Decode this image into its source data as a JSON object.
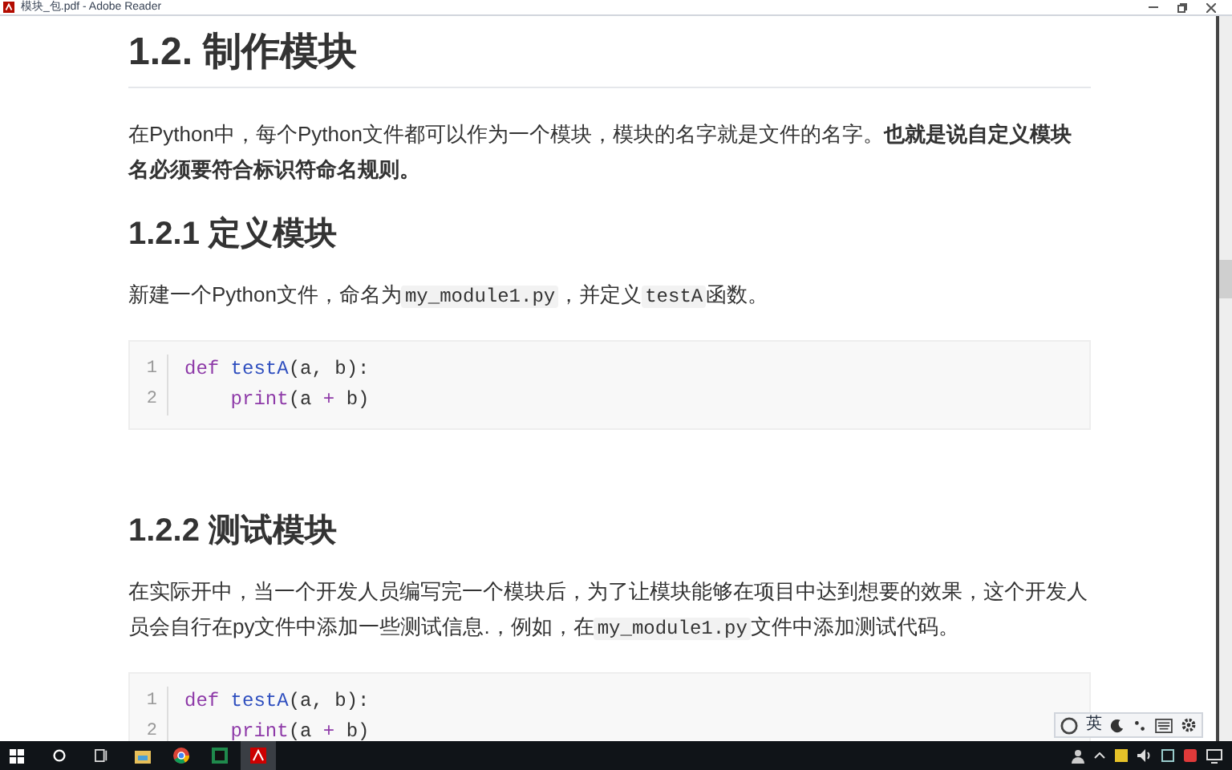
{
  "window": {
    "title": "模块_包.pdf - Adobe Reader"
  },
  "document": [
    {
      "kind": "h1",
      "text": "1.2. 制作模块"
    },
    {
      "kind": "para",
      "segments": [
        {
          "kind": "text",
          "text": "在Python中，每个Python文件都可以作为一个模块，模块的名字就是文件的名字。**也就是说自定义模块名必须要符合标识符命名规则。**"
        }
      ]
    },
    {
      "kind": "h2",
      "text": "1.2.1 定义模块"
    },
    {
      "kind": "para",
      "segments": [
        {
          "kind": "text",
          "text": "新建一个Python文件，命名为"
        },
        {
          "kind": "code",
          "text": "my_module1.py"
        },
        {
          "kind": "text",
          "text": "，并定义"
        },
        {
          "kind": "code",
          "text": "testA"
        },
        {
          "kind": "text",
          "text": "函数。"
        }
      ]
    },
    {
      "kind": "code",
      "lines": [
        {
          "number": "1",
          "tokens": [
            {
              "kind": "keyword",
              "text": "def"
            },
            {
              "kind": "function",
              "text": " testA"
            },
            {
              "kind": "plain",
              "text": "(a, b):"
            }
          ]
        },
        {
          "number": "2",
          "tokens": [
            {
              "kind": "keyword",
              "text": "    print"
            },
            {
              "kind": "plain",
              "text": "(a "
            },
            {
              "kind": "operator",
              "text": "+"
            },
            {
              "kind": "plain",
              "text": " b)"
            }
          ]
        }
      ]
    },
    {
      "kind": "h2",
      "text": "1.2.2 测试模块"
    },
    {
      "kind": "para",
      "segments": [
        {
          "kind": "text",
          "text": "在实际开中，当一个开发人员编写完一个模块后，为了让模块能够在项目中达到想要的效果，这个开发人员会自行在py文件中添加一些测试信息.，例如，在"
        },
        {
          "kind": "code",
          "text": "my_module1.py"
        },
        {
          "kind": "text",
          "text": "文件中添加测试代码。"
        }
      ]
    },
    {
      "kind": "code",
      "lines": [
        {
          "number": "1",
          "tokens": [
            {
              "kind": "keyword",
              "text": "def"
            },
            {
              "kind": "function",
              "text": " testA"
            },
            {
              "kind": "plain",
              "text": "(a, b):"
            }
          ]
        },
        {
          "number": "2",
          "tokens": [
            {
              "kind": "keyword",
              "text": "    print"
            },
            {
              "kind": "plain",
              "text": "(a "
            },
            {
              "kind": "operator",
              "text": "+"
            },
            {
              "kind": "plain",
              "text": " b)"
            }
          ]
        }
      ]
    }
  ],
  "ime_toolbar": {
    "mode": "英"
  }
}
